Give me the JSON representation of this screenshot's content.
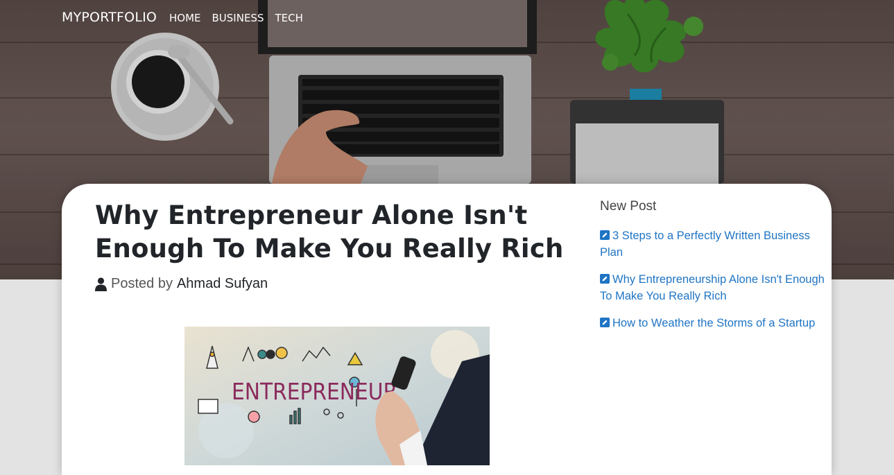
{
  "navbar": {
    "brand": "MYPORTFOLIO",
    "links": [
      {
        "label": "HOME"
      },
      {
        "label": "BUSINESS"
      },
      {
        "label": "TECH"
      }
    ]
  },
  "post": {
    "title": "Why Entrepreneur Alone Isn't Enough To Make You Really Rich",
    "byline_prefix": "Posted by",
    "author": "Ahmad Sufyan",
    "image_word": "ENTREPRENEUR"
  },
  "sidebar": {
    "title": "New Post",
    "items": [
      {
        "label": "3 Steps to a Perfectly Written Business Plan",
        "icon": "edit-icon"
      },
      {
        "label": "Why Entrepreneurship Alone Isn't Enough To Make You Really Rich",
        "icon": "edit-icon"
      },
      {
        "label": "How to Weather the Storms of a Startup",
        "icon": "edit-icon"
      }
    ]
  },
  "colors": {
    "link": "#1f74c4",
    "title": "#212529",
    "page_background": "#e3e3e3",
    "card": "#ffffff"
  }
}
